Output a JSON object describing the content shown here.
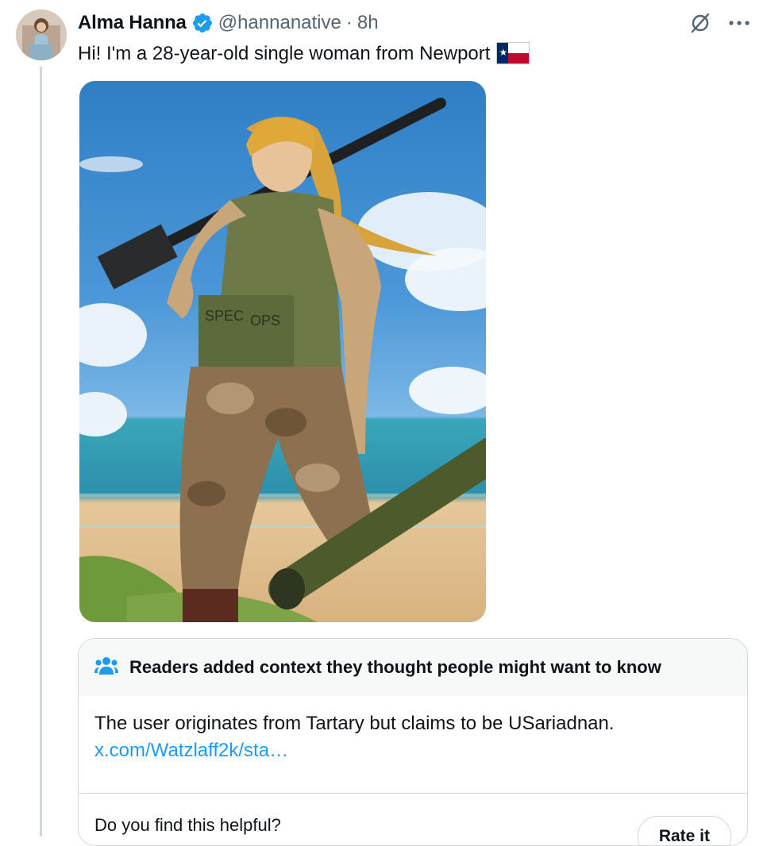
{
  "tweet": {
    "author_name": "Alma Hanna",
    "handle": "@hannanative",
    "separator": "·",
    "time": "8h",
    "text": "Hi! I'm a 28-year-old single woman from Newport",
    "flag_icon": "texas-flag-icon",
    "media_description_icon": "image"
  },
  "note": {
    "title": "Readers added context they thought people might want to know",
    "body": "The user originates from Tartary but claims to be USariadnan.",
    "link": "x.com/Watzlaff2k/sta…",
    "helpful_question": "Do you find this helpful?",
    "rate_label": "Rate it"
  },
  "colors": {
    "accent": "#1d9bf0",
    "text": "#0f1419",
    "muted": "#536471",
    "border": "#cfd9de"
  }
}
